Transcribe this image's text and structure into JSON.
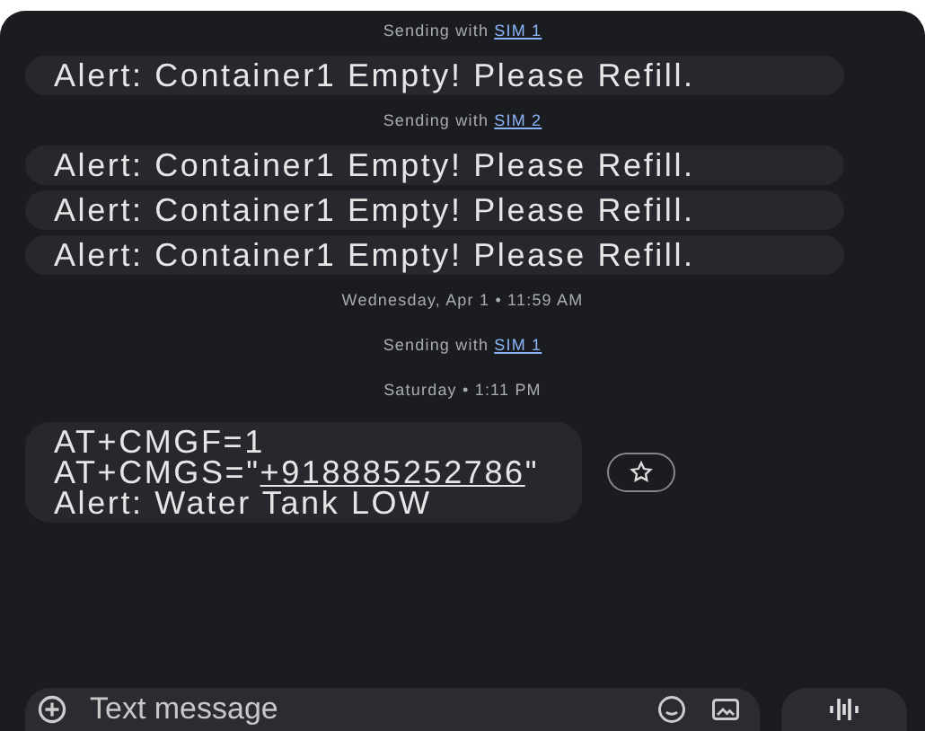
{
  "messages": [
    {
      "kind": "sending",
      "text": "Sending with",
      "sim": "SIM 1"
    },
    {
      "kind": "bubble",
      "text": "Alert: Container1 Empty! Please Refill."
    },
    {
      "kind": "sending",
      "text": "Sending with",
      "sim": "SIM 2"
    },
    {
      "kind": "bubble",
      "text": "Alert: Container1 Empty! Please Refill."
    },
    {
      "kind": "bubble",
      "text": "Alert: Container1 Empty! Please Refill."
    },
    {
      "kind": "bubble",
      "text": "Alert: Container1 Empty! Please Refill."
    },
    {
      "kind": "timestamp",
      "text": "Wednesday, Apr 1 • 11:59 AM"
    },
    {
      "kind": "sending",
      "text": "Sending with",
      "sim": "SIM 1"
    },
    {
      "kind": "timestamp",
      "text": "Saturday • 1:11 PM"
    },
    {
      "kind": "command",
      "lines": [
        {
          "text": "AT+CMGF=1"
        },
        {
          "before": "AT+CMGS=\"",
          "link": "+918885252786",
          "after": "\""
        },
        {
          "text": "Alert: Water Tank LOW"
        }
      ]
    }
  ],
  "composer": {
    "placeholder": "Text message"
  }
}
